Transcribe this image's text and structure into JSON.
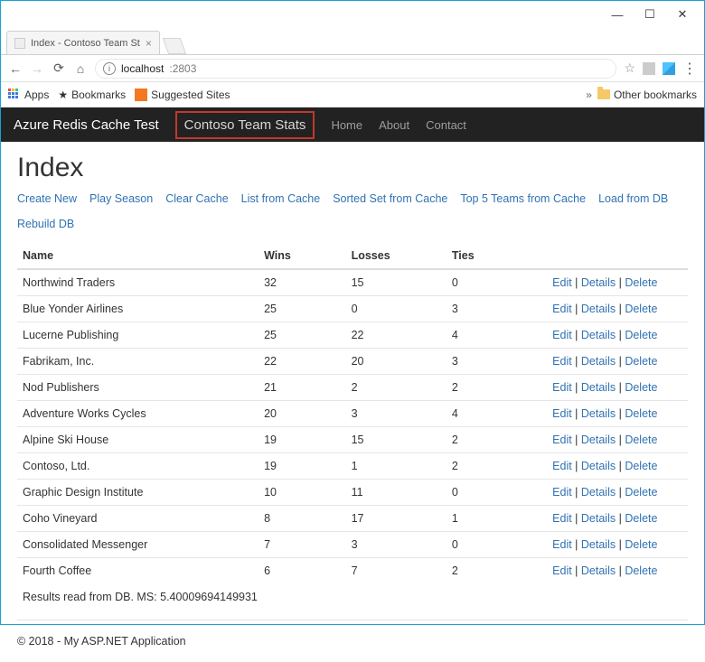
{
  "window": {
    "tab_title": "Index - Contoso Team St",
    "url_host": "localhost",
    "url_port": ":2803"
  },
  "bookmarks": {
    "apps": "Apps",
    "bookmarks": "Bookmarks",
    "suggested": "Suggested Sites",
    "other": "Other bookmarks"
  },
  "navbar": {
    "brand": "Azure Redis Cache Test",
    "highlight": "Contoso Team Stats",
    "items": [
      "Home",
      "About",
      "Contact"
    ]
  },
  "page": {
    "title": "Index",
    "links": [
      "Create New",
      "Play Season",
      "Clear Cache",
      "List from Cache",
      "Sorted Set from Cache",
      "Top 5 Teams from Cache",
      "Load from DB",
      "Rebuild DB"
    ],
    "headers": {
      "name": "Name",
      "wins": "Wins",
      "losses": "Losses",
      "ties": "Ties"
    },
    "row_actions": {
      "edit": "Edit",
      "details": "Details",
      "delete": "Delete",
      "sep": " | "
    },
    "rows": [
      {
        "name": "Northwind Traders",
        "wins": "32",
        "losses": "15",
        "ties": "0"
      },
      {
        "name": "Blue Yonder Airlines",
        "wins": "25",
        "losses": "0",
        "ties": "3"
      },
      {
        "name": "Lucerne Publishing",
        "wins": "25",
        "losses": "22",
        "ties": "4"
      },
      {
        "name": "Fabrikam, Inc.",
        "wins": "22",
        "losses": "20",
        "ties": "3"
      },
      {
        "name": "Nod Publishers",
        "wins": "21",
        "losses": "2",
        "ties": "2"
      },
      {
        "name": "Adventure Works Cycles",
        "wins": "20",
        "losses": "3",
        "ties": "4"
      },
      {
        "name": "Alpine Ski House",
        "wins": "19",
        "losses": "15",
        "ties": "2"
      },
      {
        "name": "Contoso, Ltd.",
        "wins": "19",
        "losses": "1",
        "ties": "2"
      },
      {
        "name": "Graphic Design Institute",
        "wins": "10",
        "losses": "11",
        "ties": "0"
      },
      {
        "name": "Coho Vineyard",
        "wins": "8",
        "losses": "17",
        "ties": "1"
      },
      {
        "name": "Consolidated Messenger",
        "wins": "7",
        "losses": "3",
        "ties": "0"
      },
      {
        "name": "Fourth Coffee",
        "wins": "6",
        "losses": "7",
        "ties": "2"
      }
    ],
    "status": "Results read from DB. MS: 5.40009694149931"
  },
  "footer": "© 2018 - My ASP.NET Application"
}
